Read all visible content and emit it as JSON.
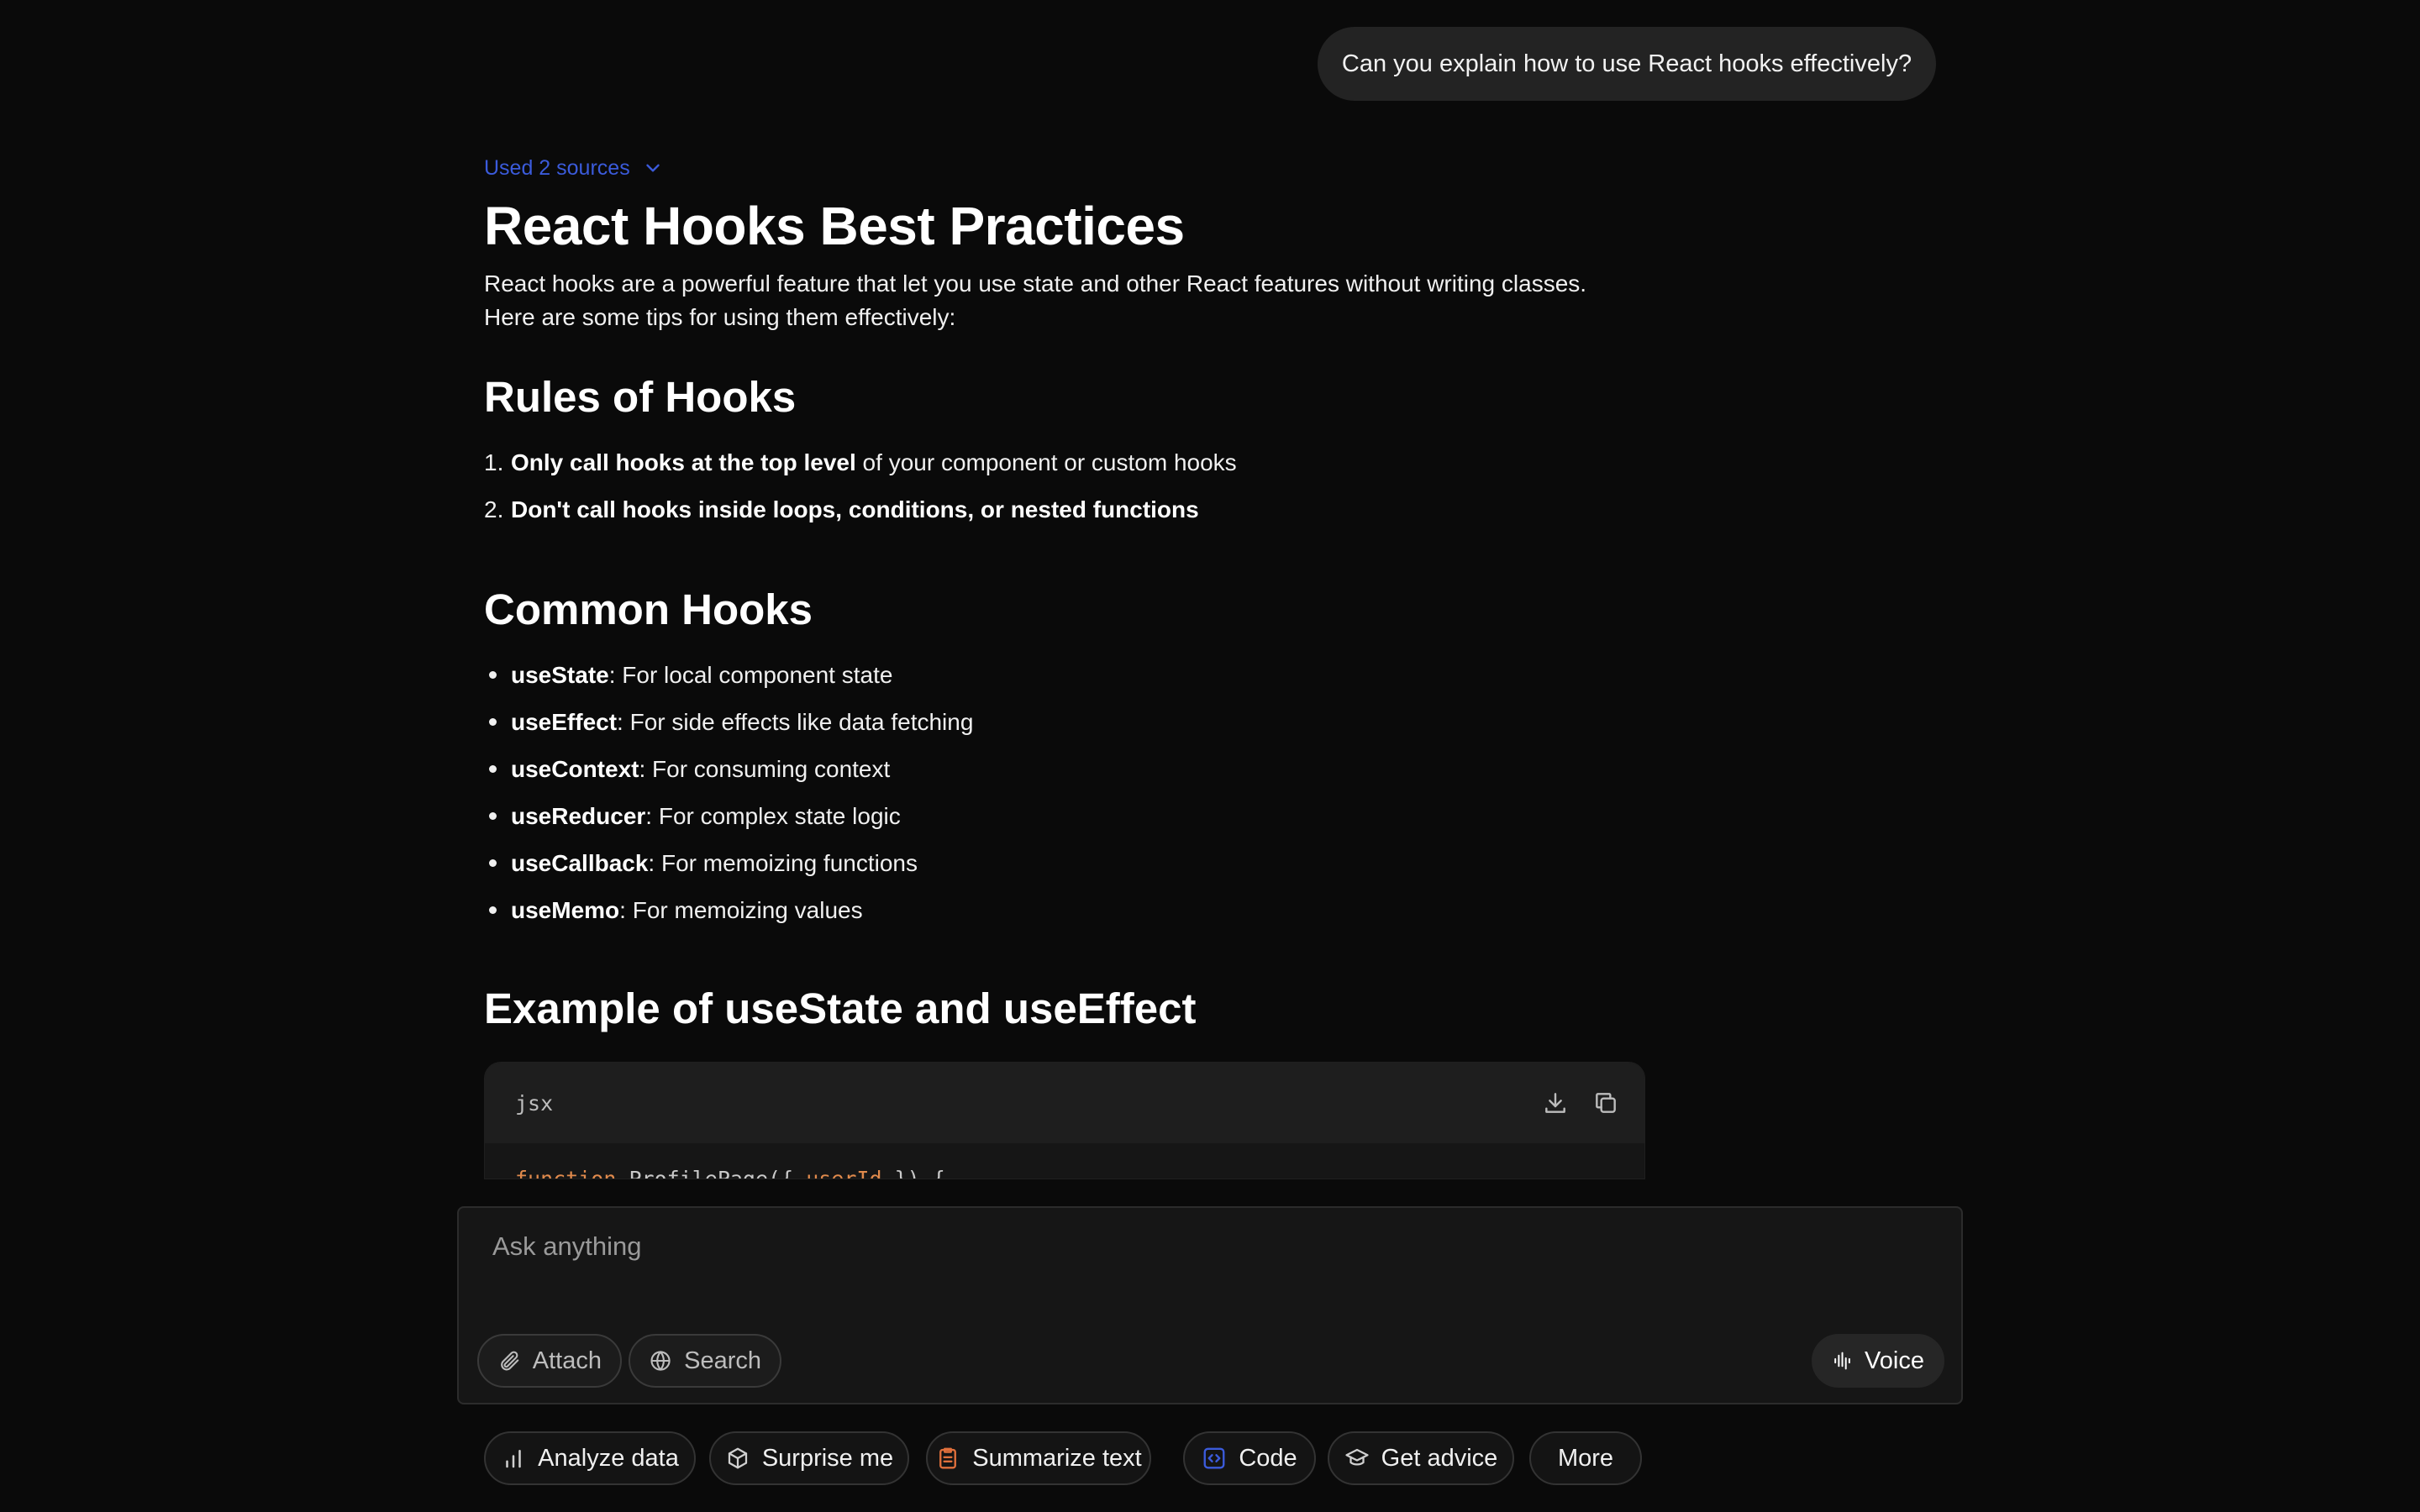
{
  "user_message": "Can you explain how to use React hooks effectively?",
  "sources_label": "Used 2 sources",
  "answer": {
    "title": "React Hooks Best Practices",
    "intro_line1": "React hooks are a powerful feature that let you use state and other React features without writing classes.",
    "intro_line2": "Here are some tips for using them effectively:",
    "rules_heading": "Rules of Hooks",
    "rules": [
      {
        "num": "1.",
        "bold": "Only call hooks at the top level",
        "rest": " of your component or custom hooks"
      },
      {
        "num": "2.",
        "bold": "Don't call hooks inside loops, conditions, or nested functions",
        "rest": ""
      }
    ],
    "common_heading": "Common Hooks",
    "hooks": [
      {
        "name": "useState",
        "desc": ": For local component state"
      },
      {
        "name": "useEffect",
        "desc": ": For side effects like data fetching"
      },
      {
        "name": "useContext",
        "desc": ": For consuming context"
      },
      {
        "name": "useReducer",
        "desc": ": For complex state logic"
      },
      {
        "name": "useCallback",
        "desc": ": For memoizing functions"
      },
      {
        "name": "useMemo",
        "desc": ": For memoizing values"
      }
    ],
    "example_heading": "Example of useState and useEffect",
    "code": {
      "lang": "jsx",
      "line_keyword": "function",
      "line_name": " ProfilePage({ ",
      "line_param": "userId",
      "line_end": " }) {"
    }
  },
  "composer": {
    "placeholder": "Ask anything",
    "attach_label": "Attach",
    "search_label": "Search",
    "voice_label": "Voice"
  },
  "chips": {
    "analyze": "Analyze data",
    "surprise": "Surprise me",
    "summarize": "Summarize text",
    "code": "Code",
    "advice": "Get advice",
    "more": "More"
  },
  "colors": {
    "background": "#0a0a0a",
    "accent_link": "#3b5bdb",
    "summarize_icon": "#e0703c",
    "code_icon": "#3b5bdb"
  }
}
